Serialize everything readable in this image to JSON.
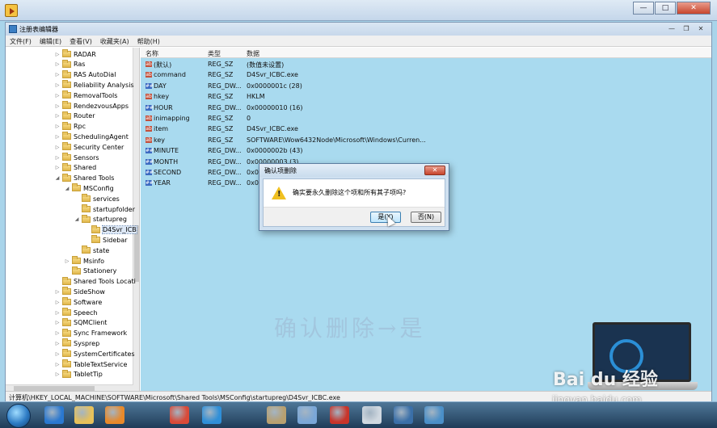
{
  "window": {
    "title": "注册表编辑器",
    "min_label": "—",
    "max_label": "□",
    "close_label": "✕"
  },
  "inner_buttons": {
    "min": "—",
    "restore": "❐",
    "close": "✕"
  },
  "menu": [
    "文件(F)",
    "编辑(E)",
    "查看(V)",
    "收藏夹(A)",
    "帮助(H)"
  ],
  "tree": [
    {
      "label": "RADAR",
      "indent": 0,
      "expand": "▷"
    },
    {
      "label": "Ras",
      "indent": 0,
      "expand": "▷"
    },
    {
      "label": "RAS AutoDial",
      "indent": 0,
      "expand": "▷"
    },
    {
      "label": "Reliability Analysis",
      "indent": 0,
      "expand": "▷"
    },
    {
      "label": "RemovalTools",
      "indent": 0,
      "expand": "▷"
    },
    {
      "label": "RendezvousApps",
      "indent": 0,
      "expand": "▷"
    },
    {
      "label": "Router",
      "indent": 0,
      "expand": "▷"
    },
    {
      "label": "Rpc",
      "indent": 0,
      "expand": "▷"
    },
    {
      "label": "SchedulingAgent",
      "indent": 0,
      "expand": "▷"
    },
    {
      "label": "Security Center",
      "indent": 0,
      "expand": "▷"
    },
    {
      "label": "Sensors",
      "indent": 0,
      "expand": "▷"
    },
    {
      "label": "Shared",
      "indent": 0,
      "expand": "▷"
    },
    {
      "label": "Shared Tools",
      "indent": 0,
      "expand": "◢"
    },
    {
      "label": "MSConfig",
      "indent": 1,
      "expand": "◢"
    },
    {
      "label": "services",
      "indent": 2,
      "expand": ""
    },
    {
      "label": "startupfolder",
      "indent": 2,
      "expand": ""
    },
    {
      "label": "startupreg",
      "indent": 2,
      "expand": "◢"
    },
    {
      "label": "D4Svr_ICB",
      "indent": 3,
      "expand": "",
      "selected": true
    },
    {
      "label": "Sidebar",
      "indent": 3,
      "expand": ""
    },
    {
      "label": "state",
      "indent": 2,
      "expand": ""
    },
    {
      "label": "Msinfo",
      "indent": 1,
      "expand": "▷"
    },
    {
      "label": "Stationery",
      "indent": 1,
      "expand": ""
    },
    {
      "label": "Shared Tools Locati",
      "indent": 0,
      "expand": ""
    },
    {
      "label": "SideShow",
      "indent": 0,
      "expand": "▷"
    },
    {
      "label": "Software",
      "indent": 0,
      "expand": "▷"
    },
    {
      "label": "Speech",
      "indent": 0,
      "expand": "▷"
    },
    {
      "label": "SQMClient",
      "indent": 0,
      "expand": "▷"
    },
    {
      "label": "Sync Framework",
      "indent": 0,
      "expand": "▷"
    },
    {
      "label": "Sysprep",
      "indent": 0,
      "expand": "▷"
    },
    {
      "label": "SystemCertificates",
      "indent": 0,
      "expand": "▷"
    },
    {
      "label": "TableTextService",
      "indent": 0,
      "expand": "▷"
    },
    {
      "label": "TabletTip",
      "indent": 0,
      "expand": "▷"
    }
  ],
  "columns": {
    "name": "名称",
    "type": "类型",
    "data": "数据"
  },
  "values": [
    {
      "icon": "ab",
      "kind": "sz",
      "name": "(默认)",
      "type": "REG_SZ",
      "data": "(数值未设置)"
    },
    {
      "icon": "ab",
      "kind": "sz",
      "name": "command",
      "type": "REG_SZ",
      "data": "D4Svr_ICBC.exe"
    },
    {
      "icon": "##",
      "kind": "dw",
      "name": "DAY",
      "type": "REG_DW...",
      "data": "0x0000001c (28)"
    },
    {
      "icon": "ab",
      "kind": "sz",
      "name": "hkey",
      "type": "REG_SZ",
      "data": "HKLM"
    },
    {
      "icon": "##",
      "kind": "dw",
      "name": "HOUR",
      "type": "REG_DW...",
      "data": "0x00000010 (16)"
    },
    {
      "icon": "ab",
      "kind": "sz",
      "name": "inimapping",
      "type": "REG_SZ",
      "data": "0"
    },
    {
      "icon": "ab",
      "kind": "sz",
      "name": "item",
      "type": "REG_SZ",
      "data": "D4Svr_ICBC.exe"
    },
    {
      "icon": "ab",
      "kind": "sz",
      "name": "key",
      "type": "REG_SZ",
      "data": "SOFTWARE\\Wow6432Node\\Microsoft\\Windows\\Curren..."
    },
    {
      "icon": "##",
      "kind": "dw",
      "name": "MINUTE",
      "type": "REG_DW...",
      "data": "0x0000002b (43)"
    },
    {
      "icon": "##",
      "kind": "dw",
      "name": "MONTH",
      "type": "REG_DW...",
      "data": "0x00000003 (3)"
    },
    {
      "icon": "##",
      "kind": "dw",
      "name": "SECOND",
      "type": "REG_DW...",
      "data": "0x0000..."
    },
    {
      "icon": "##",
      "kind": "dw",
      "name": "YEAR",
      "type": "REG_DW...",
      "data": "0x000..."
    }
  ],
  "watermark": "确认删除→是",
  "statusbar": "计算机\\HKEY_LOCAL_MACHINE\\SOFTWARE\\Microsoft\\Shared Tools\\MSConfig\\startupreg\\D4Svr_ICBC.exe",
  "dialog": {
    "title": "确认项删除",
    "close": "✕",
    "icon_glyph": "!",
    "message": "确实要永久删除这个项和所有其子项吗?",
    "yes": "是(Y)",
    "no": "否(N)"
  },
  "baidu": {
    "logo": "Bai du 经验",
    "url": "jingyan.baidu.com"
  },
  "taskbar_icons": [
    "ie-icon",
    "explorer-icon",
    "media-player-icon",
    "chrome-icon",
    "app-icon",
    "paint-icon",
    "network-icon",
    "chess-icon",
    "gear-app-icon",
    "monitor-icon",
    "puzzle-icon"
  ],
  "colors": {
    "value_bg": "#a9daef",
    "dialog_bg": "#cfe0f0",
    "taskbar": "#2a4a6a"
  }
}
